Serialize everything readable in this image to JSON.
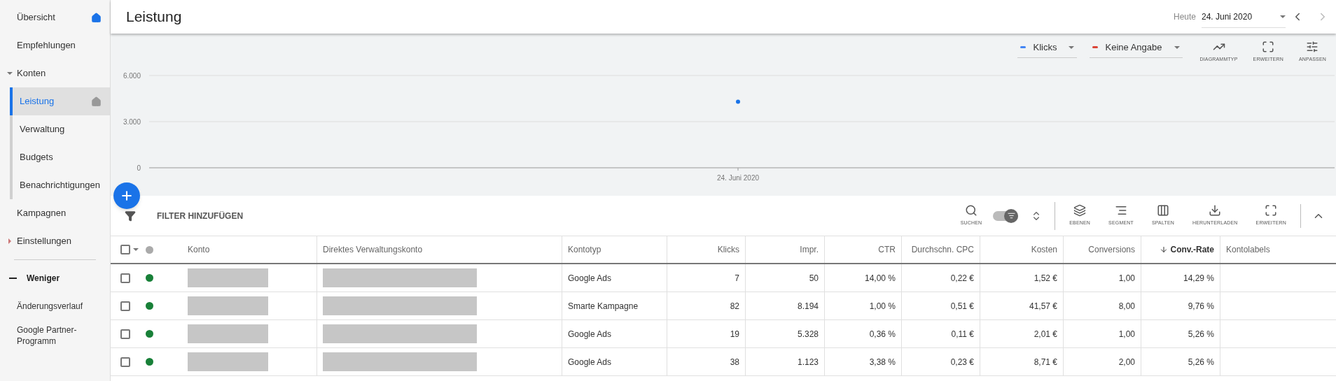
{
  "sidebar": {
    "items": [
      {
        "label": "Übersicht",
        "selected": false,
        "home": true,
        "home_highlighted": true
      },
      {
        "label": "Empfehlungen",
        "selected": false
      },
      {
        "label": "Konten",
        "selected": false,
        "expanded": true,
        "children": [
          {
            "label": "Leistung",
            "selected": true,
            "home": true,
            "home_highlighted": false
          },
          {
            "label": "Verwaltung",
            "selected": false
          },
          {
            "label": "Budgets",
            "selected": false
          },
          {
            "label": "Benachrichtigungen",
            "selected": false
          }
        ]
      },
      {
        "label": "Kampagnen",
        "selected": false
      },
      {
        "label": "Einstellungen",
        "selected": false,
        "expanded": false
      }
    ],
    "less_toggle": "Weniger",
    "extra_items": [
      {
        "label": "Änderungsverlauf",
        "selected": false
      },
      {
        "label": "Google Partner-Programm",
        "selected": false
      }
    ]
  },
  "header": {
    "title": "Leistung",
    "date_label": "Heute",
    "date_value": "24. Juni 2020"
  },
  "chart": {
    "metrics": [
      {
        "label": "Klicks",
        "color": "#4285f4"
      },
      {
        "label": "Keine Angabe",
        "color": "#db4437"
      }
    ],
    "actions": [
      "DIAGRAMMTYP",
      "ERWEITERN",
      "ANPASSEN"
    ],
    "chart_data": {
      "type": "scatter",
      "categories": [
        "24. Juni 2020"
      ],
      "series": [
        {
          "color": "#1a73e8",
          "values": [
            4300
          ]
        }
      ],
      "ylim": [
        0,
        6000
      ],
      "yticks": [
        {
          "value": 0,
          "label": "0"
        },
        {
          "value": 3000,
          "label": "3.000"
        },
        {
          "value": 6000,
          "label": "6.000"
        }
      ]
    }
  },
  "toolbar": {
    "filter_label": "FILTER HINZUFÜGEN",
    "search_label": "SUCHEN",
    "toggle_on": true,
    "actions": [
      "EBENEN",
      "SEGMENT",
      "SPALTEN",
      "HERUNTERLADEN",
      "ERWEITERN"
    ]
  },
  "table": {
    "select_all_checked": false,
    "columns": [
      {
        "label": "Konto",
        "kind": "redacted",
        "sorted": false
      },
      {
        "label": "Direktes Verwaltungskonto",
        "kind": "redacted",
        "sorted": false
      },
      {
        "label": "Kontotyp",
        "kind": "text",
        "sorted": false
      },
      {
        "label": "Klicks",
        "kind": "number",
        "sorted": false
      },
      {
        "label": "Impr.",
        "kind": "number",
        "sorted": false
      },
      {
        "label": "CTR",
        "kind": "number",
        "sorted": false
      },
      {
        "label": "Durchschn. CPC",
        "kind": "number",
        "sorted": false
      },
      {
        "label": "Kosten",
        "kind": "number",
        "sorted": false
      },
      {
        "label": "Conversions",
        "kind": "number",
        "sorted": false
      },
      {
        "label": "Conv.-Rate",
        "kind": "number",
        "sorted": true
      },
      {
        "label": "Kontolabels",
        "kind": "text",
        "sorted": false
      }
    ],
    "rows": [
      {
        "checked": false,
        "color": "#188038",
        "cells": [
          "",
          "",
          "Google Ads",
          "7",
          "50",
          "14,00 %",
          "0,22 €",
          "1,52 €",
          "1,00",
          "14,29 %"
        ]
      },
      {
        "checked": false,
        "color": "#188038",
        "cells": [
          "",
          "",
          "Smarte Kampagne",
          "82",
          "8.194",
          "1,00 %",
          "0,51 €",
          "41,57 €",
          "8,00",
          "9,76 %"
        ]
      },
      {
        "checked": false,
        "color": "#188038",
        "cells": [
          "",
          "",
          "Google Ads",
          "19",
          "5.328",
          "0,36 %",
          "0,11 €",
          "2,01 €",
          "1,00",
          "5,26 %"
        ]
      },
      {
        "checked": false,
        "color": "#188038",
        "cells": [
          "",
          "",
          "Google Ads",
          "38",
          "1.123",
          "3,38 %",
          "0,23 €",
          "8,71 €",
          "2,00",
          "5,26 %"
        ]
      }
    ]
  }
}
